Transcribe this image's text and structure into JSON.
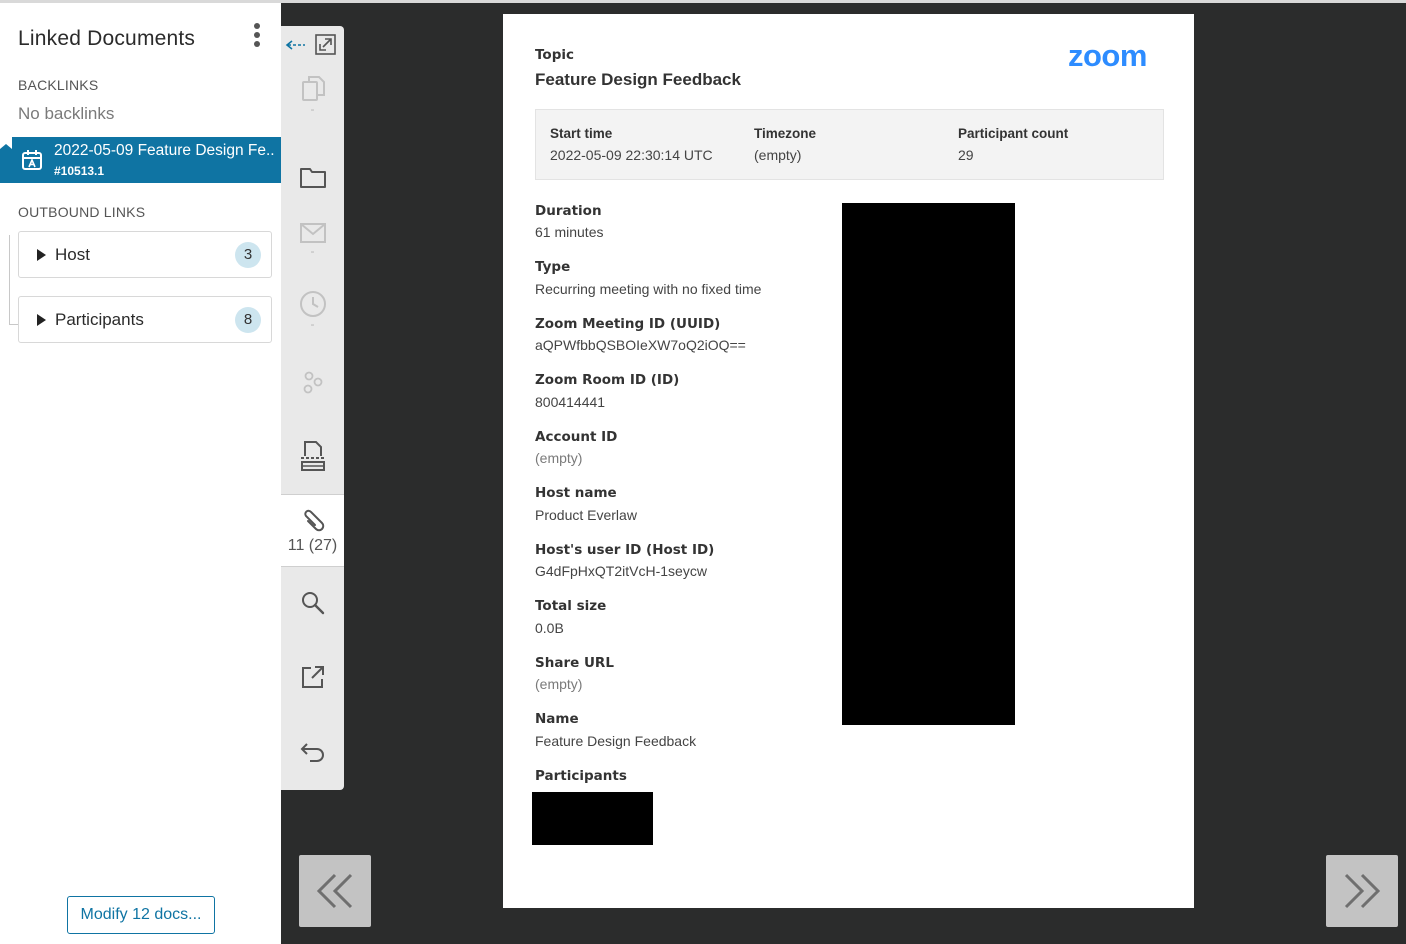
{
  "left_panel": {
    "title": "Linked Documents",
    "backlinks_heading": "BACKLINKS",
    "backlinks_empty": "No backlinks",
    "current_doc": {
      "title": "2022-05-09 Feature Design Fe...",
      "id": "#10513.1"
    },
    "outbound_heading": "OUTBOUND LINKS",
    "groups": [
      {
        "label": "Host",
        "count": "3"
      },
      {
        "label": "Participants",
        "count": "8"
      }
    ],
    "modify_button": "Modify 12 docs..."
  },
  "toolbar": {
    "dash": "-",
    "links_count": "11 (27)"
  },
  "document": {
    "logo": "zoom",
    "topic_label": "Topic",
    "topic_value": "Feature Design Feedback",
    "summary": [
      {
        "label": "Start time",
        "value": "2022-05-09 22:30:14 UTC"
      },
      {
        "label": "Timezone",
        "value": "(empty)"
      },
      {
        "label": "Participant count",
        "value": "29"
      }
    ],
    "fields": [
      {
        "label": "Duration",
        "value": "61 minutes"
      },
      {
        "label": "Type",
        "value": "Recurring meeting with no fixed time"
      },
      {
        "label": "Zoom Meeting ID (UUID)",
        "value": "aQPWfbbQSBOIeXW7oQ2iOQ=="
      },
      {
        "label": "Zoom Room ID (ID)",
        "value": "800414441"
      },
      {
        "label": "Account ID",
        "value": "(empty)"
      },
      {
        "label": "Host name",
        "value": "Product Everlaw"
      },
      {
        "label": "Host's user ID (Host ID)",
        "value": "G4dFpHxQT2itVcH-1seycw"
      },
      {
        "label": "Total size",
        "value": "0.0B"
      },
      {
        "label": "Share URL",
        "value": "(empty)"
      },
      {
        "label": "Name",
        "value": "Feature Design Feedback"
      }
    ],
    "participants_label": "Participants"
  },
  "colors": {
    "accent": "#0f74a3",
    "zoom_blue": "#2d8cff",
    "viewer_bg": "#2b2c2c"
  }
}
